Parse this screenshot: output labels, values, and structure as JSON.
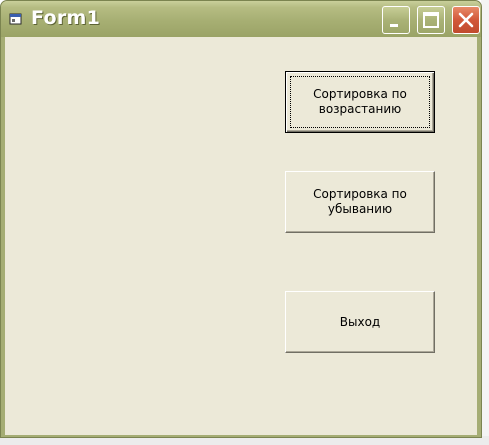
{
  "window": {
    "title": "Form1",
    "icon": "form-icon"
  },
  "caption_buttons": {
    "minimize_icon": "minimize-icon",
    "maximize_icon": "maximize-icon",
    "close_icon": "close-icon",
    "close_color": "#d2583a"
  },
  "buttons": {
    "sort_ascending": "Сортировка по\nвозрастанию",
    "sort_descending": "Сортировка по\nубыванию",
    "exit": "Выход"
  },
  "colors": {
    "titlebar": "#a7af73",
    "client": "#ece9d8"
  }
}
